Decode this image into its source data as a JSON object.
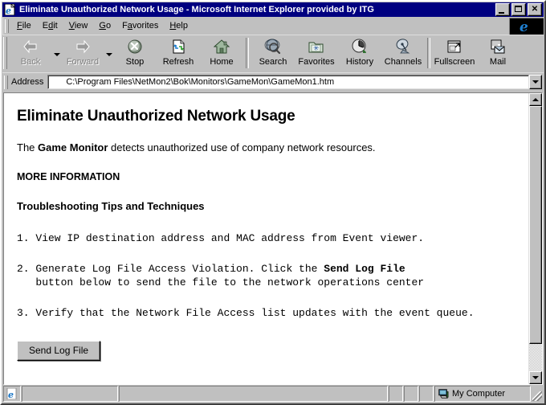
{
  "window": {
    "title": "Eliminate Unauthorized Network Usage - Microsoft Internet Explorer provided by ITG",
    "minimize_label": "_",
    "maximize_label": "",
    "close_label": "✕"
  },
  "menubar": {
    "items": [
      {
        "name": "file",
        "pre": "",
        "key": "F",
        "post": "ile"
      },
      {
        "name": "edit",
        "pre": "E",
        "key": "d",
        "post": "it"
      },
      {
        "name": "view",
        "pre": "",
        "key": "V",
        "post": "iew"
      },
      {
        "name": "go",
        "pre": "",
        "key": "G",
        "post": "o"
      },
      {
        "name": "favorites",
        "pre": "F",
        "key": "a",
        "post": "vorites"
      },
      {
        "name": "help",
        "pre": "",
        "key": "H",
        "post": "elp"
      }
    ]
  },
  "toolbar": {
    "buttons": [
      {
        "name": "back",
        "label": "Back",
        "icon": "back-arrow-icon",
        "disabled": true,
        "has_dropdown": true
      },
      {
        "name": "forward",
        "label": "Forward",
        "icon": "forward-arrow-icon",
        "disabled": true,
        "has_dropdown": true
      },
      {
        "name": "stop",
        "label": "Stop",
        "icon": "stop-icon",
        "disabled": false,
        "has_dropdown": false
      },
      {
        "name": "refresh",
        "label": "Refresh",
        "icon": "refresh-icon",
        "disabled": false,
        "has_dropdown": false
      },
      {
        "name": "home",
        "label": "Home",
        "icon": "home-icon",
        "disabled": false,
        "has_dropdown": false
      },
      {
        "name": "search",
        "label": "Search",
        "icon": "search-icon",
        "disabled": false,
        "has_dropdown": false
      },
      {
        "name": "favorites",
        "label": "Favorites",
        "icon": "favorites-folder-icon",
        "disabled": false,
        "has_dropdown": false
      },
      {
        "name": "history",
        "label": "History",
        "icon": "history-clock-icon",
        "disabled": false,
        "has_dropdown": false
      },
      {
        "name": "channels",
        "label": "Channels",
        "icon": "channels-dish-icon",
        "disabled": false,
        "has_dropdown": false
      },
      {
        "name": "fullscreen",
        "label": "Fullscreen",
        "icon": "fullscreen-icon",
        "disabled": false,
        "has_dropdown": false
      },
      {
        "name": "mail",
        "label": "Mail",
        "icon": "mail-envelope-icon",
        "disabled": false,
        "has_dropdown": false
      }
    ]
  },
  "address": {
    "label": "Address",
    "value": "C:\\Program Files\\NetMon2\\Bok\\Monitors\\GameMon\\GameMon1.htm"
  },
  "page": {
    "heading": "Eliminate Unauthorized Network Usage",
    "intro_pre": "The ",
    "intro_bold": "Game Monitor",
    "intro_post": " detects unauthorized use of company network resources.",
    "more_information": "MORE INFORMATION",
    "subheading": "Troubleshooting Tips and Techniques",
    "step1": "1. View IP destination address and MAC address from Event viewer.",
    "step2_pre": "2. Generate Log File Access Violation. Click the ",
    "step2_bold": "Send Log File",
    "step2_line2": "   button below to send the file to the network operations center",
    "step3": "3. Verify that the Network File Access list updates with the event queue.",
    "send_button": "Send Log File"
  },
  "statusbar": {
    "zone": "My Computer"
  },
  "colors": {
    "titlebar": "#000080",
    "face": "#c0c0c0",
    "content": "#ffffff",
    "disabled_text": "#808080"
  }
}
